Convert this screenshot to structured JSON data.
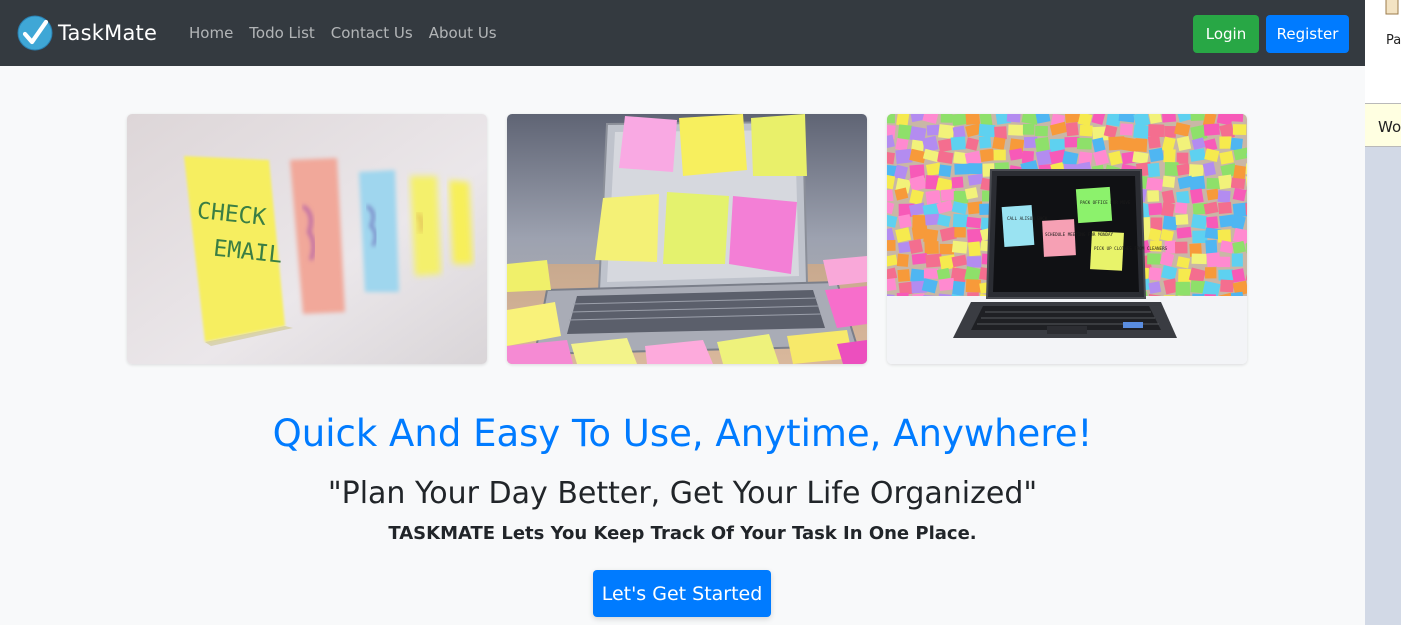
{
  "navbar": {
    "brand": "TaskMate",
    "links": [
      "Home",
      "Todo List",
      "Contact Us",
      "About Us"
    ],
    "login_label": "Login",
    "register_label": "Register"
  },
  "side": {
    "top_text": "Pa",
    "tooltip_text": "Wo"
  },
  "cards": [
    {
      "name": "sticky-notes-check-email-photo",
      "note_text": [
        "CHECK",
        "EMAIL"
      ]
    },
    {
      "name": "laptop-covered-sticky-notes-photo"
    },
    {
      "name": "laptop-sticky-notes-wall-photo",
      "note_text": [
        "CALL ALISON BACK",
        "SCHEDULE MEETING FOR MONDAY",
        "PACK OFFICE FOR MOVE",
        "PICK UP CLOTHES FROM CLEANERS"
      ]
    }
  ],
  "hero": {
    "title": "Quick And Easy To Use, Anytime, Anywhere!",
    "quote": "\"Plan Your Day Better, Get Your Life Organized\"",
    "subtitle": "TASKMATE Lets You Keep Track Of Your Task In One Place.",
    "cta_label": "Let's Get Started"
  },
  "colors": {
    "navbar": "#343a40",
    "primary": "#007bff",
    "success": "#28a745",
    "text": "#212529",
    "page_bg": "#f8f9fa"
  }
}
